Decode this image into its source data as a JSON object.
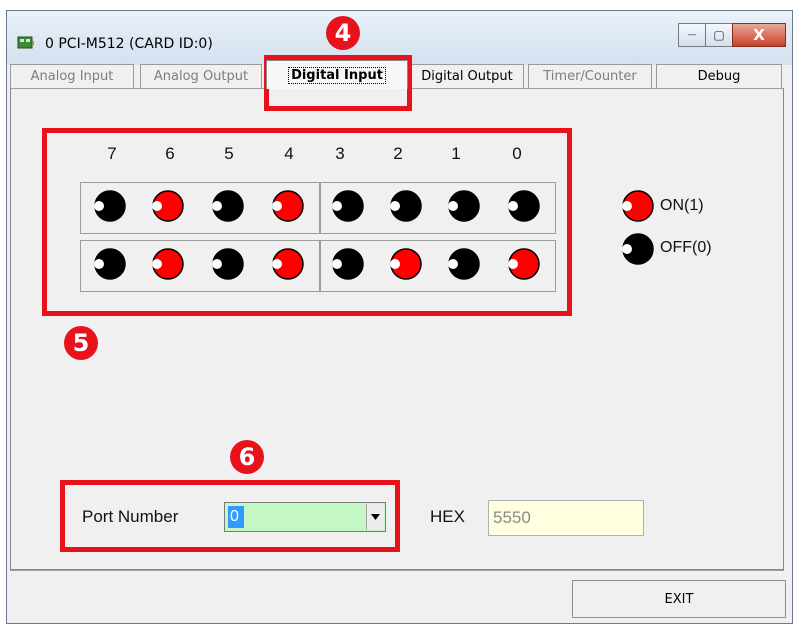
{
  "window": {
    "title": "0 PCI-M512 (CARD ID:0)",
    "caption_buttons": [
      {
        "name": "minimize-button",
        "glyph": "—"
      },
      {
        "name": "maximize-button",
        "glyph": "▢"
      },
      {
        "name": "close-button",
        "glyph": "X"
      }
    ]
  },
  "tabs": [
    {
      "label": "Analog Input",
      "accesskey": "A",
      "state": "disabled"
    },
    {
      "label": "Analog Output",
      "accesskey": "O",
      "state": "disabled"
    },
    {
      "label": "Digital Input",
      "accesskey": "I",
      "state": "active"
    },
    {
      "label": "Digital Output",
      "accesskey": "D",
      "state": "normal"
    },
    {
      "label": "Timer/Counter",
      "accesskey": "C",
      "state": "disabled"
    },
    {
      "label": "Debug",
      "accesskey": "",
      "state": "normal"
    }
  ],
  "annotations": {
    "step4": "4",
    "step5": "5",
    "step6": "6"
  },
  "bit_labels": [
    "7",
    "6",
    "5",
    "4",
    "3",
    "2",
    "1",
    "0"
  ],
  "led_rows": [
    [
      false,
      true,
      false,
      true,
      false,
      false,
      false,
      false
    ],
    [
      false,
      true,
      false,
      true,
      false,
      true,
      false,
      true
    ]
  ],
  "legend": {
    "on_label": "ON(1)",
    "off_label": "OFF(0)"
  },
  "port": {
    "label": "Port Number",
    "value": "0"
  },
  "hex": {
    "label": "HEX",
    "value": "5550"
  },
  "exit_label": "EXIT",
  "colors": {
    "annotation": "#e8121b",
    "led_on": "#ff0000",
    "led_off": "#000000",
    "combo_bg": "#c3f7c3",
    "hex_bg": "#ffffe0"
  }
}
